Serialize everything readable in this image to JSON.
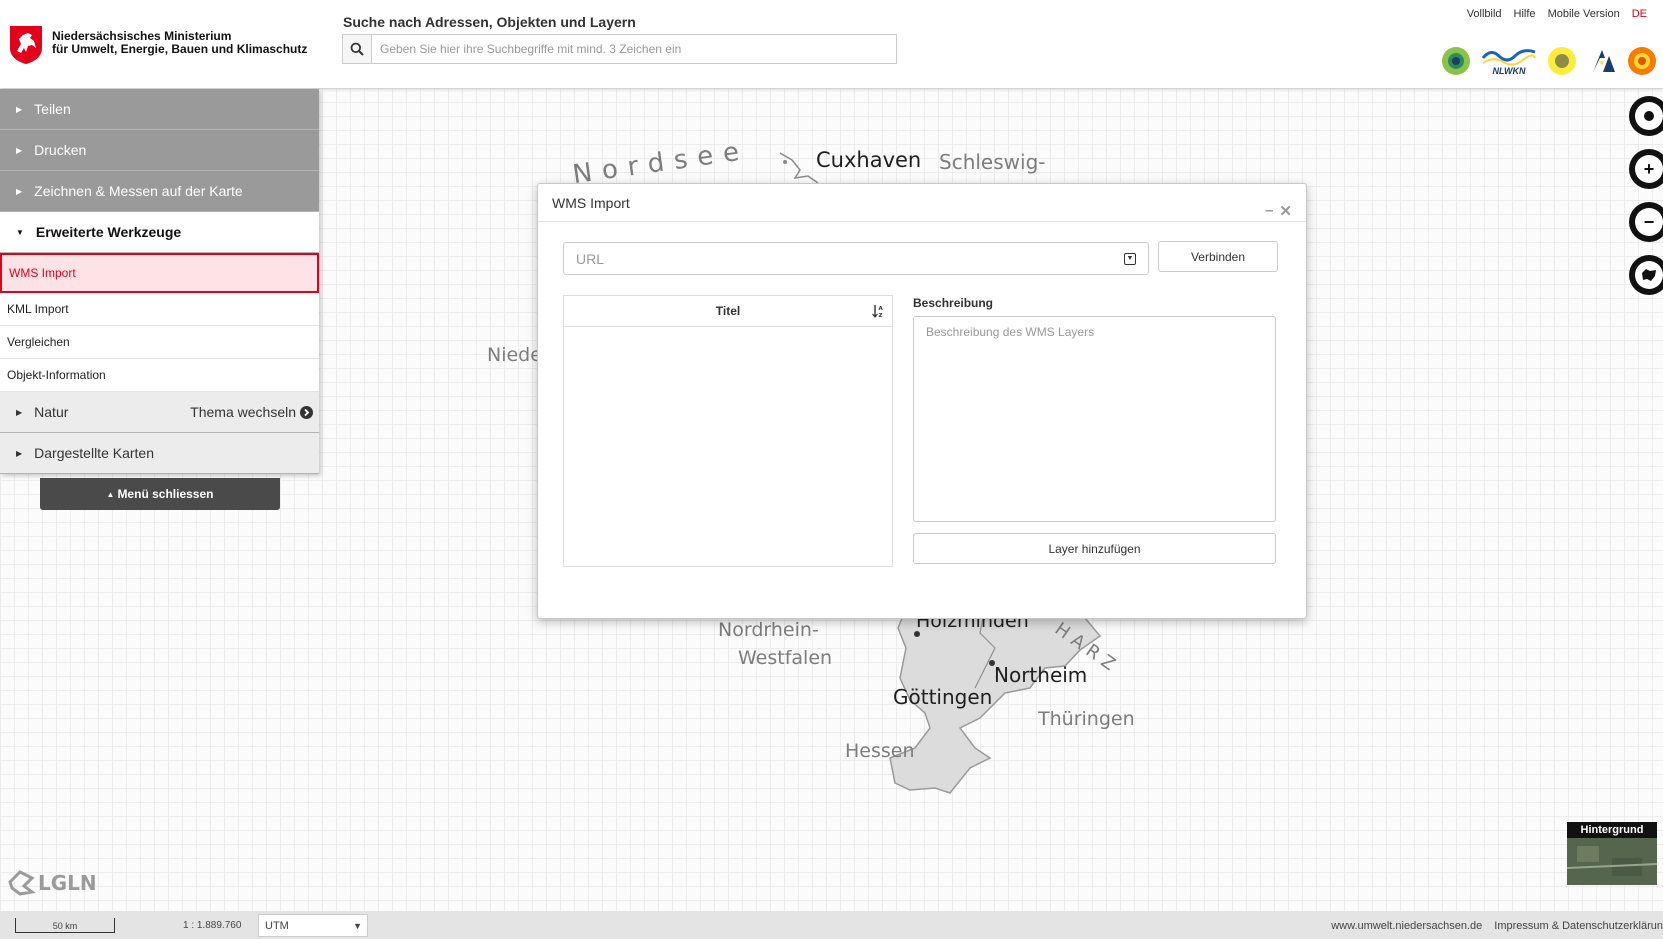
{
  "header": {
    "ministry_line1": "Niedersächsisches Ministerium",
    "ministry_line2": "für Umwelt, Energie, Bauen und Klimaschutz",
    "search_label": "Suche nach Adressen, Objekten und Layern",
    "search_placeholder": "Geben Sie hier ihre Suchbegriffe mit mind. 3 Zeichen ein",
    "links": [
      "Vollbild",
      "Hilfe",
      "Mobile Version",
      "DE"
    ],
    "partner_logo_text": "NLWKN"
  },
  "menu": {
    "sections": [
      {
        "label": "Teilen"
      },
      {
        "label": "Drucken"
      },
      {
        "label": "Zeichnen & Messen auf der Karte"
      },
      {
        "label": "Erweiterte Werkzeuge"
      }
    ],
    "tools": [
      "WMS Import",
      "KML Import",
      "Vergleichen",
      "Objekt-Information"
    ],
    "natur_label": "Natur",
    "theme_switch": "Thema wechseln",
    "maps_label": "Dargestellte Karten",
    "close_label": "Menü schliessen"
  },
  "dialog": {
    "title": "WMS Import",
    "url_placeholder": "URL",
    "connect_button": "Verbinden",
    "table_header": "Titel",
    "description_label": "Beschreibung",
    "description_placeholder": "Beschreibung des WMS Layers",
    "add_button": "Layer hinzufügen"
  },
  "map": {
    "labels": {
      "nordsee": "Nordsee",
      "cuxhaven": "Cuxhaven",
      "schleswig": "Schleswig-",
      "niede": "Niede",
      "holzminden": "Holzminden",
      "nrw1": "Nordrhein-",
      "nrw2": "Westfalen",
      "harz": "HARZ",
      "northeim": "Northeim",
      "goettingen": "Göttingen",
      "thueringen": "Thüringen",
      "hessen": "Hessen"
    },
    "background_label": "Hintergrund",
    "lgln": "LGLN"
  },
  "footer": {
    "scale_label": "50 km",
    "scale_ratio": "1 : 1.889.760",
    "projection": "UTM",
    "links": [
      "www.umwelt.niedersachsen.de",
      "Impressum & Datenschutzerklärun"
    ]
  }
}
